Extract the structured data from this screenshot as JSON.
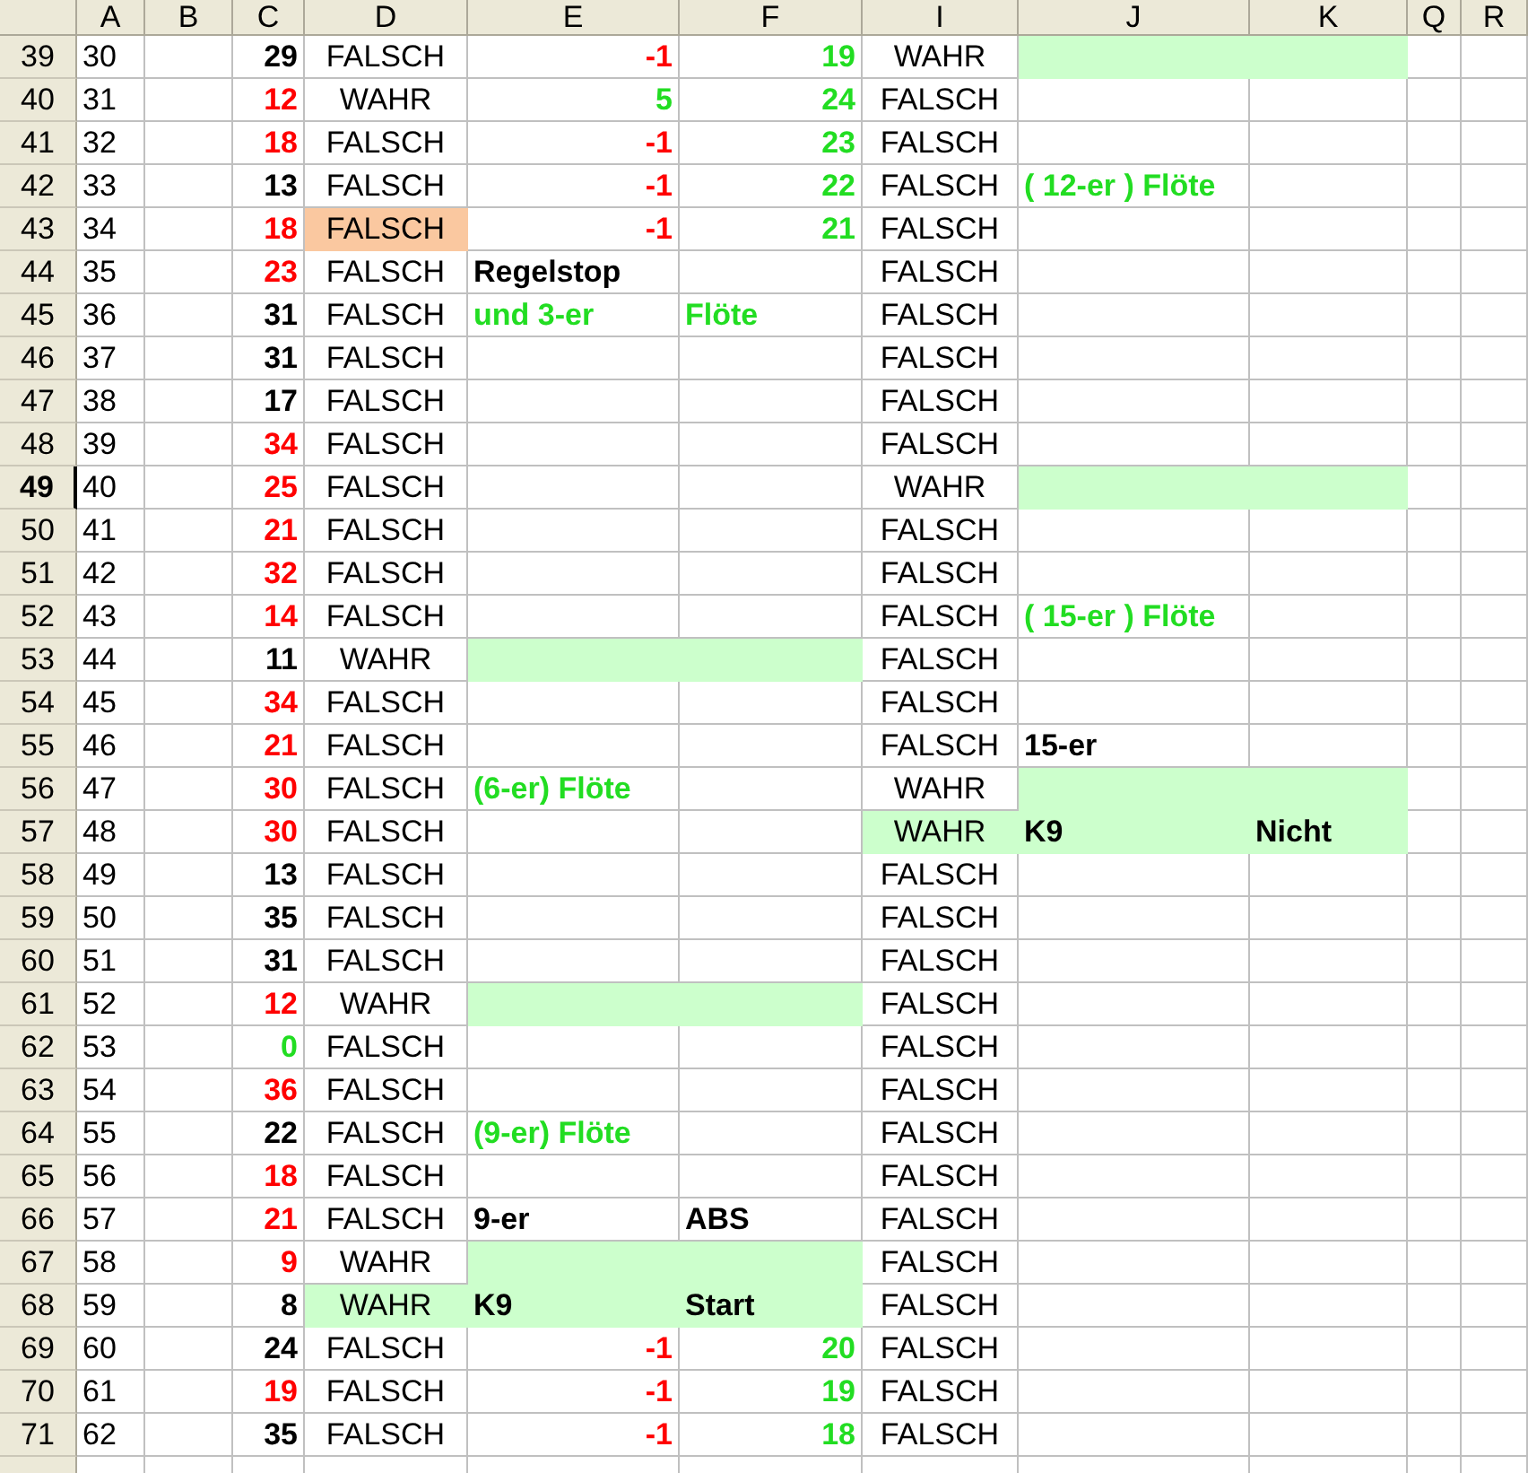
{
  "columns": [
    "A",
    "B",
    "C",
    "D",
    "E",
    "F",
    "I",
    "J",
    "K",
    "Q",
    "R"
  ],
  "rows": [
    {
      "label": "39",
      "selected": false,
      "cells": {
        "A": {
          "text": "30"
        },
        "C": {
          "kind": "number",
          "text": "29",
          "color": "#000000"
        },
        "D": {
          "kind": "bool",
          "text": "FALSCH"
        },
        "E": {
          "kind": "number",
          "text": "-1",
          "color": "#ff0000"
        },
        "F": {
          "kind": "number",
          "text": "19",
          "color": "#22dd22"
        },
        "I": {
          "kind": "bool",
          "text": "WAHR"
        },
        "J": {
          "fill": {
            "color": "#ccffcc"
          }
        },
        "K": {
          "fill": {
            "color": "#ccffcc"
          }
        }
      }
    },
    {
      "label": "40",
      "selected": false,
      "cells": {
        "A": {
          "text": "31"
        },
        "C": {
          "kind": "number",
          "text": "12",
          "color": "#ff0000"
        },
        "D": {
          "kind": "bool",
          "text": "WAHR"
        },
        "E": {
          "kind": "number",
          "text": "5",
          "color": "#22dd22"
        },
        "F": {
          "kind": "number",
          "text": "24",
          "color": "#22dd22"
        },
        "I": {
          "kind": "bool",
          "text": "FALSCH"
        }
      }
    },
    {
      "label": "41",
      "selected": false,
      "cells": {
        "A": {
          "text": "32"
        },
        "C": {
          "kind": "number",
          "text": "18",
          "color": "#ff0000"
        },
        "D": {
          "kind": "bool",
          "text": "FALSCH"
        },
        "E": {
          "kind": "number",
          "text": "-1",
          "color": "#ff0000"
        },
        "F": {
          "kind": "number",
          "text": "23",
          "color": "#22dd22"
        },
        "I": {
          "kind": "bool",
          "text": "FALSCH"
        }
      }
    },
    {
      "label": "42",
      "selected": false,
      "cells": {
        "A": {
          "text": "33"
        },
        "C": {
          "kind": "number",
          "text": "13",
          "color": "#000000"
        },
        "D": {
          "kind": "bool",
          "text": "FALSCH"
        },
        "E": {
          "kind": "number",
          "text": "-1",
          "color": "#ff0000"
        },
        "F": {
          "kind": "number",
          "text": "22",
          "color": "#22dd22"
        },
        "I": {
          "kind": "bool",
          "text": "FALSCH"
        },
        "J": {
          "kind": "label",
          "text": "( 12-er ) Flöte",
          "color": "#22dd22"
        }
      }
    },
    {
      "label": "43",
      "selected": false,
      "cells": {
        "A": {
          "text": "34"
        },
        "C": {
          "kind": "number",
          "text": "18",
          "color": "#ff0000"
        },
        "D": {
          "kind": "bool",
          "text": "FALSCH",
          "fill": {
            "color": "#fac8a0"
          }
        },
        "E": {
          "kind": "number",
          "text": "-1",
          "color": "#ff0000"
        },
        "F": {
          "kind": "number",
          "text": "21",
          "color": "#22dd22"
        },
        "I": {
          "kind": "bool",
          "text": "FALSCH"
        }
      }
    },
    {
      "label": "44",
      "selected": false,
      "cells": {
        "A": {
          "text": "35"
        },
        "C": {
          "kind": "number",
          "text": "23",
          "color": "#ff0000"
        },
        "D": {
          "kind": "bool",
          "text": "FALSCH"
        },
        "E": {
          "kind": "label",
          "text": "Regelstop",
          "color": "#000000"
        },
        "I": {
          "kind": "bool",
          "text": "FALSCH"
        }
      }
    },
    {
      "label": "45",
      "selected": false,
      "cells": {
        "A": {
          "text": "36"
        },
        "C": {
          "kind": "number",
          "text": "31",
          "color": "#000000"
        },
        "D": {
          "kind": "bool",
          "text": "FALSCH"
        },
        "E": {
          "kind": "label",
          "text": "und 3-er",
          "color": "#22dd22"
        },
        "F": {
          "kind": "label",
          "text": "Flöte",
          "color": "#22dd22"
        },
        "I": {
          "kind": "bool",
          "text": "FALSCH"
        }
      }
    },
    {
      "label": "46",
      "selected": false,
      "cells": {
        "A": {
          "text": "37"
        },
        "C": {
          "kind": "number",
          "text": "31",
          "color": "#000000"
        },
        "D": {
          "kind": "bool",
          "text": "FALSCH"
        },
        "I": {
          "kind": "bool",
          "text": "FALSCH"
        }
      }
    },
    {
      "label": "47",
      "selected": false,
      "cells": {
        "A": {
          "text": "38"
        },
        "C": {
          "kind": "number",
          "text": "17",
          "color": "#000000"
        },
        "D": {
          "kind": "bool",
          "text": "FALSCH"
        },
        "I": {
          "kind": "bool",
          "text": "FALSCH"
        }
      }
    },
    {
      "label": "48",
      "selected": false,
      "cells": {
        "A": {
          "text": "39"
        },
        "C": {
          "kind": "number",
          "text": "34",
          "color": "#ff0000"
        },
        "D": {
          "kind": "bool",
          "text": "FALSCH"
        },
        "I": {
          "kind": "bool",
          "text": "FALSCH"
        }
      }
    },
    {
      "label": "49",
      "selected": true,
      "cells": {
        "A": {
          "text": "40"
        },
        "C": {
          "kind": "number",
          "text": "25",
          "color": "#ff0000"
        },
        "D": {
          "kind": "bool",
          "text": "FALSCH"
        },
        "I": {
          "kind": "bool",
          "text": "WAHR"
        },
        "J": {
          "fill": {
            "color": "#ccffcc"
          }
        },
        "K": {
          "fill": {
            "color": "#ccffcc"
          }
        }
      }
    },
    {
      "label": "50",
      "selected": false,
      "cells": {
        "A": {
          "text": "41"
        },
        "C": {
          "kind": "number",
          "text": "21",
          "color": "#ff0000"
        },
        "D": {
          "kind": "bool",
          "text": "FALSCH"
        },
        "I": {
          "kind": "bool",
          "text": "FALSCH"
        }
      }
    },
    {
      "label": "51",
      "selected": false,
      "cells": {
        "A": {
          "text": "42"
        },
        "C": {
          "kind": "number",
          "text": "32",
          "color": "#ff0000"
        },
        "D": {
          "kind": "bool",
          "text": "FALSCH"
        },
        "I": {
          "kind": "bool",
          "text": "FALSCH"
        }
      }
    },
    {
      "label": "52",
      "selected": false,
      "cells": {
        "A": {
          "text": "43"
        },
        "C": {
          "kind": "number",
          "text": "14",
          "color": "#ff0000"
        },
        "D": {
          "kind": "bool",
          "text": "FALSCH"
        },
        "I": {
          "kind": "bool",
          "text": "FALSCH"
        },
        "J": {
          "kind": "label",
          "text": "( 15-er ) Flöte",
          "color": "#22dd22"
        }
      }
    },
    {
      "label": "53",
      "selected": false,
      "cells": {
        "A": {
          "text": "44"
        },
        "C": {
          "kind": "number",
          "text": "11",
          "color": "#000000"
        },
        "D": {
          "kind": "bool",
          "text": "WAHR"
        },
        "E": {
          "fill": {
            "color": "#ccffcc"
          }
        },
        "F": {
          "fill": {
            "color": "#ccffcc"
          }
        },
        "I": {
          "kind": "bool",
          "text": "FALSCH"
        }
      }
    },
    {
      "label": "54",
      "selected": false,
      "cells": {
        "A": {
          "text": "45"
        },
        "C": {
          "kind": "number",
          "text": "34",
          "color": "#ff0000"
        },
        "D": {
          "kind": "bool",
          "text": "FALSCH"
        },
        "I": {
          "kind": "bool",
          "text": "FALSCH"
        }
      }
    },
    {
      "label": "55",
      "selected": false,
      "cells": {
        "A": {
          "text": "46"
        },
        "C": {
          "kind": "number",
          "text": "21",
          "color": "#ff0000"
        },
        "D": {
          "kind": "bool",
          "text": "FALSCH"
        },
        "I": {
          "kind": "bool",
          "text": "FALSCH"
        },
        "J": {
          "kind": "label",
          "text": "15-er",
          "color": "#000000"
        }
      }
    },
    {
      "label": "56",
      "selected": false,
      "cells": {
        "A": {
          "text": "47"
        },
        "C": {
          "kind": "number",
          "text": "30",
          "color": "#ff0000"
        },
        "D": {
          "kind": "bool",
          "text": "FALSCH"
        },
        "E": {
          "kind": "label",
          "text": "(6-er) Flöte",
          "color": "#22dd22"
        },
        "I": {
          "kind": "bool",
          "text": "WAHR"
        },
        "J": {
          "fill": {
            "color": "#ccffcc"
          }
        },
        "K": {
          "fill": {
            "color": "#ccffcc"
          }
        }
      }
    },
    {
      "label": "57",
      "selected": false,
      "cells": {
        "A": {
          "text": "48"
        },
        "C": {
          "kind": "number",
          "text": "30",
          "color": "#ff0000"
        },
        "D": {
          "kind": "bool",
          "text": "FALSCH"
        },
        "I": {
          "kind": "bool",
          "text": "WAHR",
          "fill": {
            "color": "#ccffcc"
          }
        },
        "J": {
          "kind": "label",
          "text": "K9",
          "color": "#000000",
          "fill": {
            "color": "#ccffcc"
          }
        },
        "K": {
          "kind": "label",
          "text": "Nicht",
          "color": "#000000",
          "fill": {
            "color": "#ccffcc"
          }
        }
      }
    },
    {
      "label": "58",
      "selected": false,
      "cells": {
        "A": {
          "text": "49"
        },
        "C": {
          "kind": "number",
          "text": "13",
          "color": "#000000"
        },
        "D": {
          "kind": "bool",
          "text": "FALSCH"
        },
        "I": {
          "kind": "bool",
          "text": "FALSCH"
        }
      }
    },
    {
      "label": "59",
      "selected": false,
      "cells": {
        "A": {
          "text": "50"
        },
        "C": {
          "kind": "number",
          "text": "35",
          "color": "#000000"
        },
        "D": {
          "kind": "bool",
          "text": "FALSCH"
        },
        "I": {
          "kind": "bool",
          "text": "FALSCH"
        }
      }
    },
    {
      "label": "60",
      "selected": false,
      "cells": {
        "A": {
          "text": "51"
        },
        "C": {
          "kind": "number",
          "text": "31",
          "color": "#000000"
        },
        "D": {
          "kind": "bool",
          "text": "FALSCH"
        },
        "I": {
          "kind": "bool",
          "text": "FALSCH"
        }
      }
    },
    {
      "label": "61",
      "selected": false,
      "cells": {
        "A": {
          "text": "52"
        },
        "C": {
          "kind": "number",
          "text": "12",
          "color": "#ff0000"
        },
        "D": {
          "kind": "bool",
          "text": "WAHR"
        },
        "E": {
          "fill": {
            "color": "#ccffcc"
          }
        },
        "F": {
          "fill": {
            "color": "#ccffcc"
          }
        },
        "I": {
          "kind": "bool",
          "text": "FALSCH"
        }
      }
    },
    {
      "label": "62",
      "selected": false,
      "cells": {
        "A": {
          "text": "53"
        },
        "C": {
          "kind": "number",
          "text": "0",
          "color": "#22dd22"
        },
        "D": {
          "kind": "bool",
          "text": "FALSCH"
        },
        "I": {
          "kind": "bool",
          "text": "FALSCH"
        }
      }
    },
    {
      "label": "63",
      "selected": false,
      "cells": {
        "A": {
          "text": "54"
        },
        "C": {
          "kind": "number",
          "text": "36",
          "color": "#ff0000"
        },
        "D": {
          "kind": "bool",
          "text": "FALSCH"
        },
        "I": {
          "kind": "bool",
          "text": "FALSCH"
        }
      }
    },
    {
      "label": "64",
      "selected": false,
      "cells": {
        "A": {
          "text": "55"
        },
        "C": {
          "kind": "number",
          "text": "22",
          "color": "#000000"
        },
        "D": {
          "kind": "bool",
          "text": "FALSCH"
        },
        "E": {
          "kind": "label",
          "text": "(9-er) Flöte",
          "color": "#22dd22"
        },
        "I": {
          "kind": "bool",
          "text": "FALSCH"
        }
      }
    },
    {
      "label": "65",
      "selected": false,
      "cells": {
        "A": {
          "text": "56"
        },
        "C": {
          "kind": "number",
          "text": "18",
          "color": "#ff0000"
        },
        "D": {
          "kind": "bool",
          "text": "FALSCH"
        },
        "I": {
          "kind": "bool",
          "text": "FALSCH"
        }
      }
    },
    {
      "label": "66",
      "selected": false,
      "cells": {
        "A": {
          "text": "57"
        },
        "C": {
          "kind": "number",
          "text": "21",
          "color": "#ff0000"
        },
        "D": {
          "kind": "bool",
          "text": "FALSCH"
        },
        "E": {
          "kind": "label",
          "text": "9-er",
          "color": "#000000"
        },
        "F": {
          "kind": "label",
          "text": "ABS",
          "color": "#000000"
        },
        "I": {
          "kind": "bool",
          "text": "FALSCH"
        }
      }
    },
    {
      "label": "67",
      "selected": false,
      "cells": {
        "A": {
          "text": "58"
        },
        "C": {
          "kind": "number",
          "text": "9",
          "color": "#ff0000"
        },
        "D": {
          "kind": "bool",
          "text": "WAHR"
        },
        "E": {
          "fill": {
            "color": "#ccffcc"
          }
        },
        "F": {
          "fill": {
            "color": "#ccffcc"
          }
        },
        "I": {
          "kind": "bool",
          "text": "FALSCH"
        }
      }
    },
    {
      "label": "68",
      "selected": false,
      "cells": {
        "A": {
          "text": "59"
        },
        "C": {
          "kind": "number",
          "text": "8",
          "color": "#000000"
        },
        "D": {
          "kind": "bool",
          "text": "WAHR",
          "fill": {
            "color": "#ccffcc"
          }
        },
        "E": {
          "kind": "label",
          "text": "K9",
          "color": "#000000",
          "fill": {
            "color": "#ccffcc"
          }
        },
        "F": {
          "kind": "label",
          "text": "Start",
          "color": "#000000",
          "fill": {
            "color": "#ccffcc"
          }
        },
        "I": {
          "kind": "bool",
          "text": "FALSCH"
        }
      }
    },
    {
      "label": "69",
      "selected": false,
      "cells": {
        "A": {
          "text": "60"
        },
        "C": {
          "kind": "number",
          "text": "24",
          "color": "#000000"
        },
        "D": {
          "kind": "bool",
          "text": "FALSCH"
        },
        "E": {
          "kind": "number",
          "text": "-1",
          "color": "#ff0000"
        },
        "F": {
          "kind": "number",
          "text": "20",
          "color": "#22dd22"
        },
        "I": {
          "kind": "bool",
          "text": "FALSCH"
        }
      }
    },
    {
      "label": "70",
      "selected": false,
      "cells": {
        "A": {
          "text": "61"
        },
        "C": {
          "kind": "number",
          "text": "19",
          "color": "#ff0000"
        },
        "D": {
          "kind": "bool",
          "text": "FALSCH"
        },
        "E": {
          "kind": "number",
          "text": "-1",
          "color": "#ff0000"
        },
        "F": {
          "kind": "number",
          "text": "19",
          "color": "#22dd22"
        },
        "I": {
          "kind": "bool",
          "text": "FALSCH"
        }
      }
    },
    {
      "label": "71",
      "selected": false,
      "cells": {
        "A": {
          "text": "62"
        },
        "C": {
          "kind": "number",
          "text": "35",
          "color": "#000000"
        },
        "D": {
          "kind": "bool",
          "text": "FALSCH"
        },
        "E": {
          "kind": "number",
          "text": "-1",
          "color": "#ff0000"
        },
        "F": {
          "kind": "number",
          "text": "18",
          "color": "#22dd22"
        },
        "I": {
          "kind": "bool",
          "text": "FALSCH"
        }
      }
    }
  ]
}
